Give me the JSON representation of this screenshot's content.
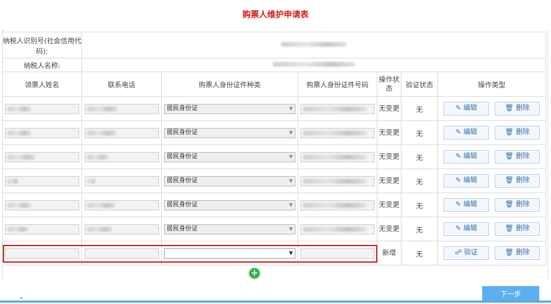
{
  "title": "购票人维护申请表",
  "taxpayer": {
    "id_label": "纳税人识别号(社会信用代码):",
    "name_label": "纳税人名称:"
  },
  "columns": [
    "领票人姓名",
    "联系电话",
    "购票人身份证件种类",
    "购票人身份证件号码",
    "操作状态",
    "验证状态",
    "操作类型"
  ],
  "rows": [
    {
      "id_type": "居民身份证",
      "op_status": "无变更",
      "verify": "无",
      "action1": "编辑",
      "action2": "删除"
    },
    {
      "id_type": "居民身份证",
      "op_status": "无变更",
      "verify": "无",
      "action1": "编辑",
      "action2": "删除"
    },
    {
      "id_type": "居民身份证",
      "op_status": "无变更",
      "verify": "无",
      "action1": "编辑",
      "action2": "删除"
    },
    {
      "id_type": "居民身份证",
      "op_status": "无变更",
      "verify": "无",
      "action1": "编辑",
      "action2": "删除"
    },
    {
      "id_type": "居民身份证",
      "op_status": "无变更",
      "verify": "无",
      "action1": "编辑",
      "action2": "删除"
    },
    {
      "id_type": "居民身份证",
      "op_status": "无变更",
      "verify": "无",
      "action1": "编辑",
      "action2": "删除"
    }
  ],
  "new_row": {
    "id_type": "",
    "op_status": "新增",
    "verify": "无",
    "action1": "验证",
    "action2": "删除"
  },
  "icons": {
    "edit": "edit-icon",
    "delete": "trash-icon",
    "verify": "verify-icon",
    "add": "plus-circle-icon",
    "dropdown": "chevron-down-icon"
  },
  "colors": {
    "title": "#d21f1f",
    "highlight_border": "#c9302c",
    "add_button": "#2bb24c",
    "next_button": "#5cb0ef"
  },
  "next_label": "下一步"
}
